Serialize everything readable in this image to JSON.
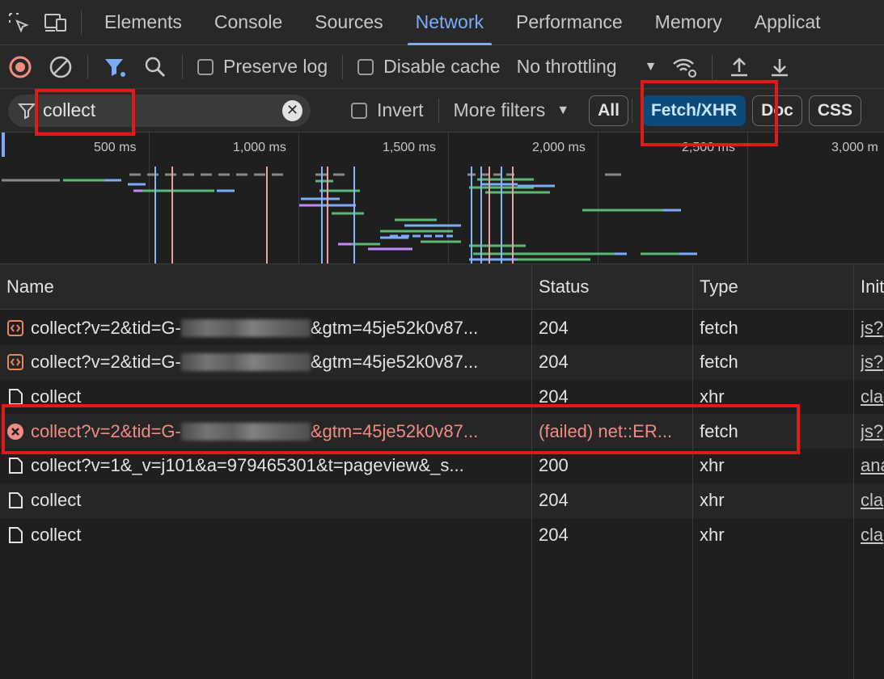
{
  "tabs": [
    "Elements",
    "Console",
    "Sources",
    "Network",
    "Performance",
    "Memory",
    "Applicat"
  ],
  "active_tab": "Network",
  "toolbar": {
    "preserve_log": "Preserve log",
    "disable_cache": "Disable cache",
    "throttling": "No throttling"
  },
  "filter": {
    "value": "collect",
    "invert": "Invert",
    "more_filters": "More filters",
    "chips": [
      "All",
      "Fetch/XHR",
      "Doc",
      "CSS"
    ],
    "selected_chip": "Fetch/XHR"
  },
  "overview": {
    "ticks": [
      "500 ms",
      "1,000 ms",
      "1,500 ms",
      "2,000 ms",
      "2,500 ms",
      "3,000 m"
    ]
  },
  "table": {
    "columns": [
      "Name",
      "Status",
      "Type",
      "Init"
    ],
    "rows": [
      {
        "icon": "fetch-icon",
        "name_pre": "collect?v=2&tid=G-",
        "name_post": "&gtm=45je52k0v87...",
        "status": "204",
        "type": "fetch",
        "initiator": "js?",
        "error": false
      },
      {
        "icon": "fetch-icon",
        "name_pre": "collect?v=2&tid=G-",
        "name_post": "&gtm=45je52k0v87...",
        "status": "204",
        "type": "fetch",
        "initiator": "js?",
        "error": false
      },
      {
        "icon": "document-icon",
        "name_pre": "collect",
        "name_post": "",
        "status": "204",
        "type": "xhr",
        "initiator": "cla",
        "error": false
      },
      {
        "icon": "error-icon",
        "name_pre": "collect?v=2&tid=G-",
        "name_post": "&gtm=45je52k0v87...",
        "status": "(failed) net::ER...",
        "type": "fetch",
        "initiator": "js?",
        "error": true
      },
      {
        "icon": "document-icon",
        "name_pre": "collect?v=1&_v=j101&a=979465301&t=pageview&_s...",
        "name_post": "",
        "status": "200",
        "type": "xhr",
        "initiator": "ana",
        "error": false
      },
      {
        "icon": "document-icon",
        "name_pre": "collect",
        "name_post": "",
        "status": "204",
        "type": "xhr",
        "initiator": "cla",
        "error": false
      },
      {
        "icon": "document-icon",
        "name_pre": "collect",
        "name_post": "",
        "status": "204",
        "type": "xhr",
        "initiator": "cla",
        "error": false
      }
    ]
  },
  "colors": {
    "accent": "#7cacf8",
    "record": "#f28b82",
    "highlight_box": "#e01919",
    "chip_selected": "#0b4a7a"
  }
}
